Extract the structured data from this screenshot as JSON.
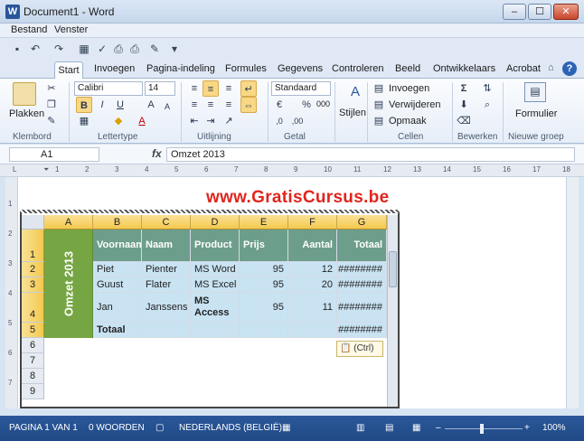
{
  "window": {
    "title": "Document1 - Word",
    "app_icon": "W",
    "minimize": "–",
    "maximize": "☐",
    "close": "✕"
  },
  "menu": [
    "Bestand",
    "Venster"
  ],
  "tabs": {
    "active": "Start",
    "items": [
      "Invoegen",
      "Pagina-indeling",
      "Formules",
      "Gegevens",
      "Controleren",
      "Beeld",
      "Ontwikkelaars",
      "Acrobat"
    ],
    "help": "?"
  },
  "ribbon": {
    "clipboard": {
      "paste": "Plakken",
      "label": "Klembord"
    },
    "font": {
      "name": "Calibri",
      "size": "14",
      "label": "Lettertype",
      "bold": "B",
      "italic": "I",
      "underline": "U"
    },
    "alignment": {
      "label": "Uitlijning"
    },
    "number": {
      "format": "Standaard",
      "percent": "%",
      "thousands": "000",
      "label": "Getal"
    },
    "styles": {
      "button": "Stijlen"
    },
    "cells": {
      "insert": "Invoegen",
      "delete": "Verwijderen",
      "format": "Opmaak",
      "label": "Cellen"
    },
    "editing": {
      "label": "Bewerken",
      "sum": "Σ"
    },
    "new_group": {
      "button": "Formulier",
      "label": "Nieuwe groep"
    }
  },
  "formula_bar": {
    "cell_ref": "A1",
    "fx": "fx",
    "value": "Omzet  2013"
  },
  "watermark": "www.GratisCursus.be",
  "sheet": {
    "columns": [
      "A",
      "B",
      "C",
      "D",
      "E",
      "F",
      "G"
    ],
    "rows": [
      "1",
      "2",
      "3",
      "4",
      "5",
      "6",
      "7",
      "8",
      "9"
    ],
    "merged_label": "Omzet  2013",
    "header": [
      "Voornaam",
      "Naam",
      "Product",
      "Prijs",
      "Aantal",
      "Totaal"
    ],
    "data": [
      [
        "Piet",
        "Pienter",
        "MS Word",
        "95",
        "12",
        "########"
      ],
      [
        "Guust",
        "Flater",
        "MS Excel",
        "95",
        "20",
        "########"
      ],
      [
        "Jan",
        "Janssens",
        "MS Access",
        "95",
        "11",
        "########"
      ]
    ],
    "total_label": "Totaal",
    "total_value": "########"
  },
  "paste_options": "(Ctrl)",
  "status": {
    "page": "PAGINA 1 VAN 1",
    "words": "0 WOORDEN",
    "language": "NEDERLANDS (BELGIË)",
    "zoom": "100%",
    "zoom_out": "–",
    "zoom_in": "+"
  }
}
